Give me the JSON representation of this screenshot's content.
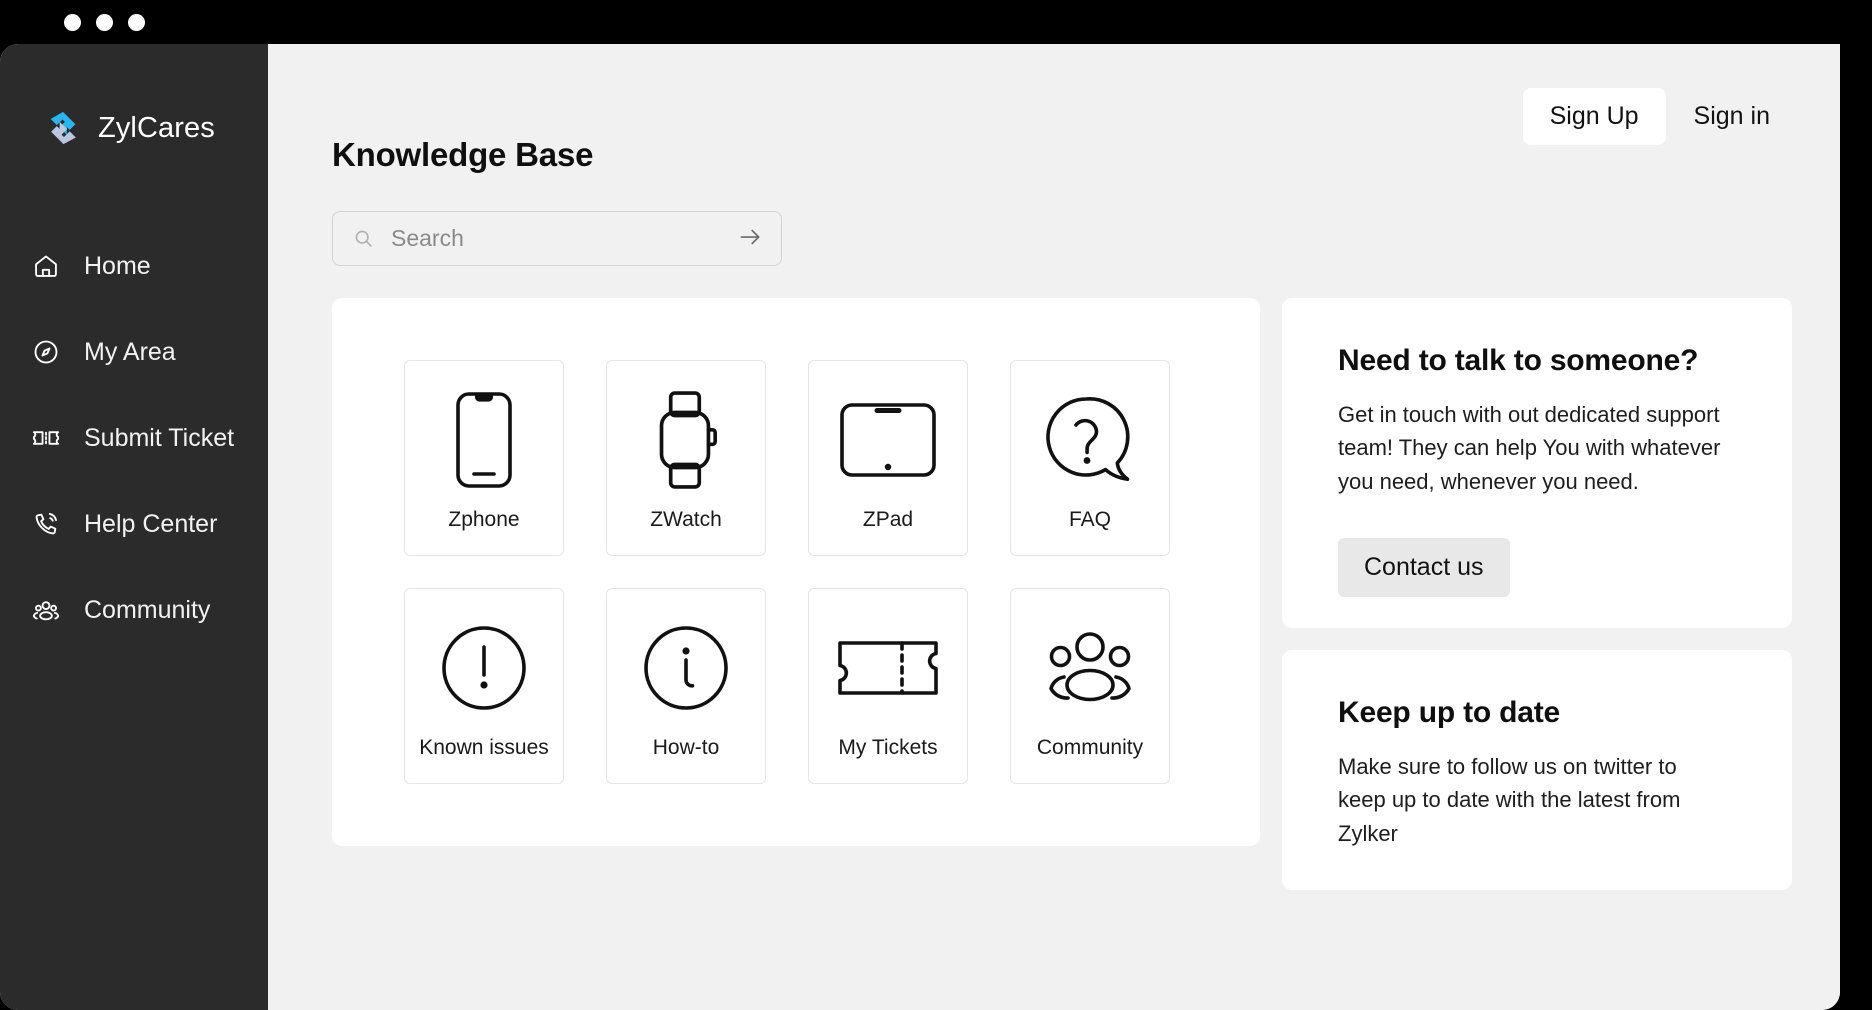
{
  "window": {
    "traffic_lights": [
      "close",
      "minimize",
      "maximize"
    ]
  },
  "sidebar": {
    "brand_name": "ZylCares",
    "logo_colors": {
      "top": "#29b6f0",
      "bottom": "#b9c7e0"
    },
    "background": "#2b2b2b",
    "items": [
      {
        "label": "Home",
        "icon": "home-icon"
      },
      {
        "label": "My Area",
        "icon": "compass-icon"
      },
      {
        "label": "Submit Ticket",
        "icon": "ticket-icon"
      },
      {
        "label": "Help Center",
        "icon": "phone-call-icon"
      },
      {
        "label": "Community",
        "icon": "people-icon"
      }
    ]
  },
  "topbar": {
    "sign_up_label": "Sign Up",
    "sign_in_label": "Sign in"
  },
  "main": {
    "page_title": "Knowledge Base"
  },
  "search": {
    "placeholder": "Search",
    "value": "",
    "icon": "magnifier-icon",
    "submit_icon": "arrow-right-icon"
  },
  "categories": [
    {
      "label": "Zphone",
      "icon": "phone-device-icon"
    },
    {
      "label": "ZWatch",
      "icon": "smartwatch-icon"
    },
    {
      "label": "ZPad",
      "icon": "tablet-icon"
    },
    {
      "label": "FAQ",
      "icon": "question-bubble-icon"
    },
    {
      "label": "Known issues",
      "icon": "exclamation-circle-icon"
    },
    {
      "label": "How-to",
      "icon": "info-circle-icon"
    },
    {
      "label": "My Tickets",
      "icon": "ticket-stub-icon"
    },
    {
      "label": "Community",
      "icon": "people-group-icon"
    }
  ],
  "contact_card": {
    "title": "Need to talk to someone?",
    "body": "Get in touch with out dedicated support team! They can help You with whatever you need, whenever you need.",
    "button_label": "Contact us"
  },
  "twitter_card": {
    "title": "Keep up to date",
    "body": "Make sure to follow us on twitter to keep up to date with the latest from Zylker"
  }
}
